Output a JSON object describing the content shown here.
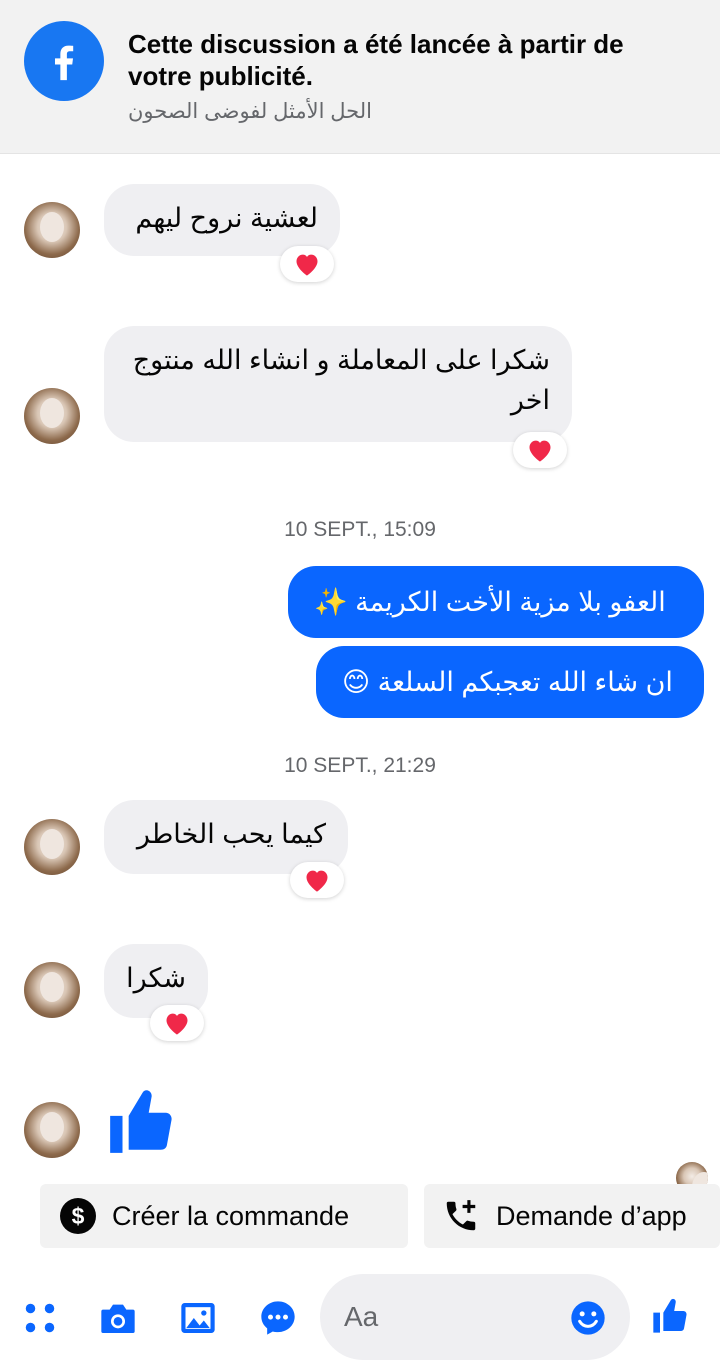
{
  "banner": {
    "title": "Cette discussion a été lancée à partir de votre publicité.",
    "subtitle": "الحل الأمثل لفوضى الصحون"
  },
  "messages": [
    {
      "text": "لعشية نروح ليهم",
      "reaction": "❤️"
    },
    {
      "text": "شكرا على المعاملة و انشاء الله منتوج اخر",
      "reaction": "❤️"
    },
    {
      "timestamp": "10 SEPT., 15:09"
    },
    {
      "text": "العفو بلا مزية الأخت الكريمة ✨"
    },
    {
      "text": "ان شاء الله تعجبكم السلعة 😊"
    },
    {
      "timestamp": "10 SEPT., 21:29"
    },
    {
      "text": "كيما يحب الخاطر",
      "reaction": "❤️"
    },
    {
      "text": "شكرا",
      "reaction": "❤️"
    }
  ],
  "quick_actions": [
    {
      "label": "Créer la commande",
      "icon": "dollar-icon"
    },
    {
      "label": "Demande d’app",
      "icon": "phone-add-icon"
    }
  ],
  "composer": {
    "placeholder": "Aa",
    "icons": [
      "menu-dots-icon",
      "camera-icon",
      "image-icon",
      "chat-apps-icon",
      "emoji-icon",
      "like-icon"
    ]
  },
  "colors": {
    "accent": "#0a66ff",
    "brand": "#1877f2",
    "incoming_bubble": "#efeff2",
    "heart": "#f02849"
  }
}
